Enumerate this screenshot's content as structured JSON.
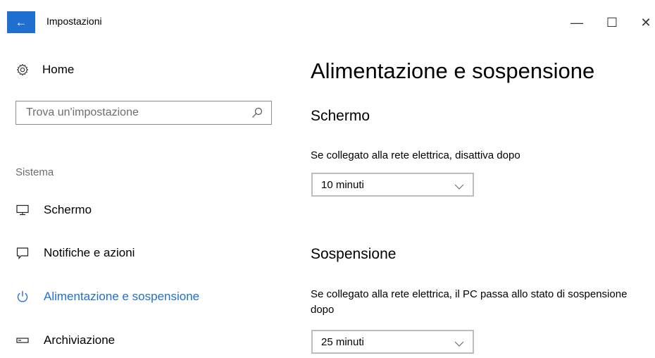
{
  "window": {
    "title": "Impostazioni",
    "back_symbol": "←",
    "minimize_symbol": "—",
    "maximize_symbol": "☐",
    "close_symbol": "✕",
    "accent_color": "#1f6fd1"
  },
  "sidebar": {
    "home_label": "Home",
    "search_placeholder": "Trova un'impostazione",
    "section_label": "Sistema",
    "items": [
      {
        "label": "Schermo",
        "icon": "monitor-icon",
        "active": false
      },
      {
        "label": "Notifiche e azioni",
        "icon": "notification-icon",
        "active": false
      },
      {
        "label": "Alimentazione e sospensione",
        "icon": "power-icon",
        "active": true
      },
      {
        "label": "Archiviazione",
        "icon": "storage-icon",
        "active": false
      }
    ]
  },
  "main": {
    "title": "Alimentazione e sospensione",
    "screen": {
      "heading": "Schermo",
      "label": "Se collegato alla rete elettrica, disattiva dopo",
      "value": "10 minuti"
    },
    "sleep": {
      "heading": "Sospensione",
      "label": "Se collegato alla rete elettrica, il PC passa allo stato di sospensione dopo",
      "value": "25 minuti"
    }
  }
}
